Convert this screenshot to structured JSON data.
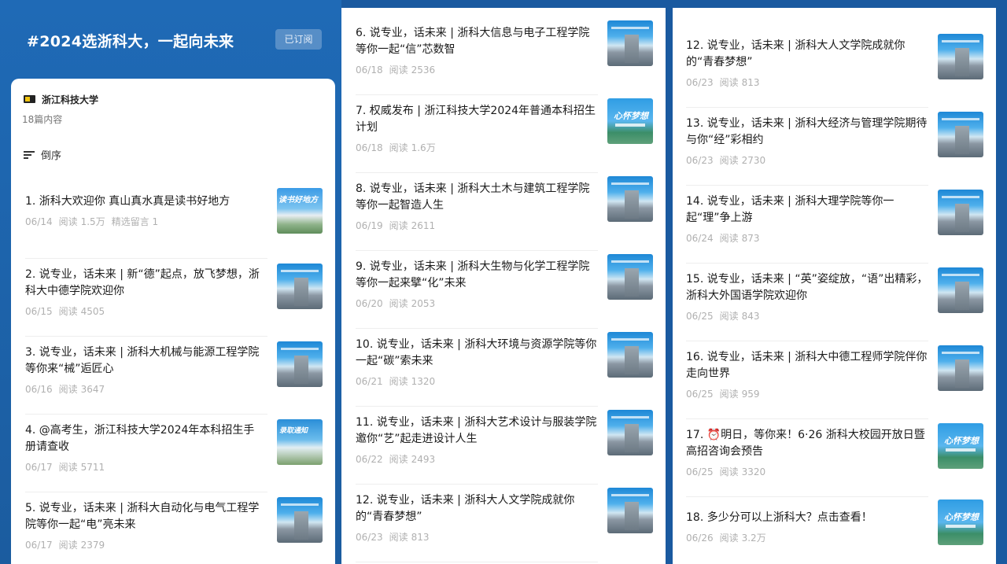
{
  "topic": {
    "title": "#2024选浙科大，一起向未来",
    "subscribe_label": "已订阅"
  },
  "account": {
    "name": "浙江科技大学",
    "article_count": "18篇内容",
    "sort_label": "倒序"
  },
  "read_label": "阅读",
  "thumbnail_text": {
    "reading": "读书好地方",
    "guide": "录取通知",
    "dream": "心怀梦想"
  },
  "articles": [
    {
      "title": "1. 浙科大欢迎你 真山真水真是读书好地方",
      "date": "06/14",
      "reads": "1.5万",
      "extra": "精选留言 1"
    },
    {
      "title": "2. 说专业，话未来 | 新“德”起点，放飞梦想，浙科大中德学院欢迎你",
      "date": "06/15",
      "reads": "4505"
    },
    {
      "title": "3. 说专业，话未来 | 浙科大机械与能源工程学院等你来“械”逅匠心",
      "date": "06/16",
      "reads": "3647"
    },
    {
      "title": "4. @高考生，浙江科技大学2024年本科招生手册请查收",
      "date": "06/17",
      "reads": "5711"
    },
    {
      "title": "5. 说专业，话未来 | 浙科大自动化与电气工程学院等你一起“电”亮未来",
      "date": "06/17",
      "reads": "2379"
    },
    {
      "title": "6. 说专业，话未来 | 浙科大信息与电子工程学院等你一起“信”芯数智",
      "date": "06/18",
      "reads": "2536"
    },
    {
      "title": "7. 权威发布 | 浙江科技大学2024年普通本科招生计划",
      "date": "06/18",
      "reads": "1.6万"
    },
    {
      "title": "8. 说专业，话未来 | 浙科大土木与建筑工程学院等你一起智造人生",
      "date": "06/19",
      "reads": "2611"
    },
    {
      "title": "9. 说专业，话未来 | 浙科大生物与化学工程学院等你一起来擘“化”未来",
      "date": "06/20",
      "reads": "2053"
    },
    {
      "title": "10. 说专业，话未来 | 浙科大环境与资源学院等你一起“碳”索未来",
      "date": "06/21",
      "reads": "1320"
    },
    {
      "title": "11. 说专业，话未来 | 浙科大艺术设计与服装学院邀你“艺”起走进设计人生",
      "date": "06/22",
      "reads": "2493"
    },
    {
      "title": "12. 说专业，话未来 | 浙科大人文学院成就你的“青春梦想”",
      "date": "06/23",
      "reads": "813"
    },
    {
      "title": "13. 说专业，话未来 | 浙科大经济与管理学院期待与你“经”彩相约",
      "date": "06/23",
      "reads": "2730"
    },
    {
      "title": "14. 说专业，话未来 | 浙科大理学院等你一起“理”争上游",
      "date": "06/24",
      "reads": "873"
    },
    {
      "title": "15. 说专业，话未来 | “英”姿绽放，“语”出精彩，浙科大外国语学院欢迎你",
      "date": "06/25",
      "reads": "843"
    },
    {
      "title": "16. 说专业，话未来 | 浙科大中德工程师学院伴你走向世界",
      "date": "06/25",
      "reads": "959"
    },
    {
      "title": "17. ⏰明日，等你来！6·26 浙科大校园开放日暨高招咨询会预告",
      "date": "06/25",
      "reads": "3320"
    },
    {
      "title": "18. 多少分可以上浙科大？点击查看！",
      "date": "06/26",
      "reads": "3.2万"
    }
  ]
}
